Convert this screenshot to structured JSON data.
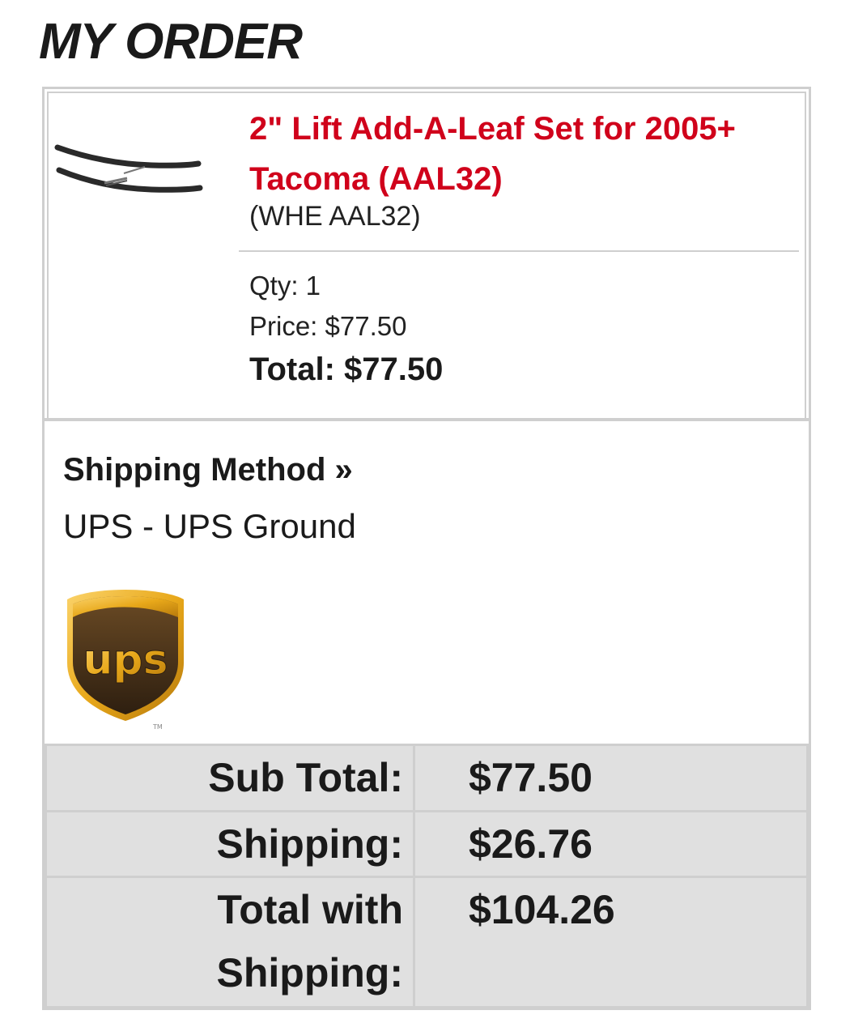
{
  "page": {
    "title": "MY ORDER"
  },
  "product": {
    "title": "2\" Lift Add-A-Leaf Set for 2005+ Tacoma (AAL32)",
    "sku": "(WHE AAL32)",
    "qty_text": "Qty: 1",
    "price_text": "Price: $77.50",
    "total_text": "Total: $77.50",
    "image": "leaf-spring-product-image"
  },
  "shipping": {
    "heading": "Shipping Method »",
    "method": "UPS - UPS Ground",
    "logo": "ups-shield-logo"
  },
  "totals": {
    "sub_total_label": "Sub Total:",
    "sub_total_value": "$77.50",
    "shipping_label": "Shipping:",
    "shipping_value": "$26.76",
    "grand_total_label_line1": "Total with",
    "grand_total_label_line2": "Shipping:",
    "grand_total_value": "$104.26"
  },
  "colors": {
    "accent_red": "#d0021b",
    "border_gray": "#cfcfcf",
    "table_bg": "#e0e0e0",
    "ups_brown": "#3b2a1a",
    "ups_gold": "#f2b21b"
  }
}
